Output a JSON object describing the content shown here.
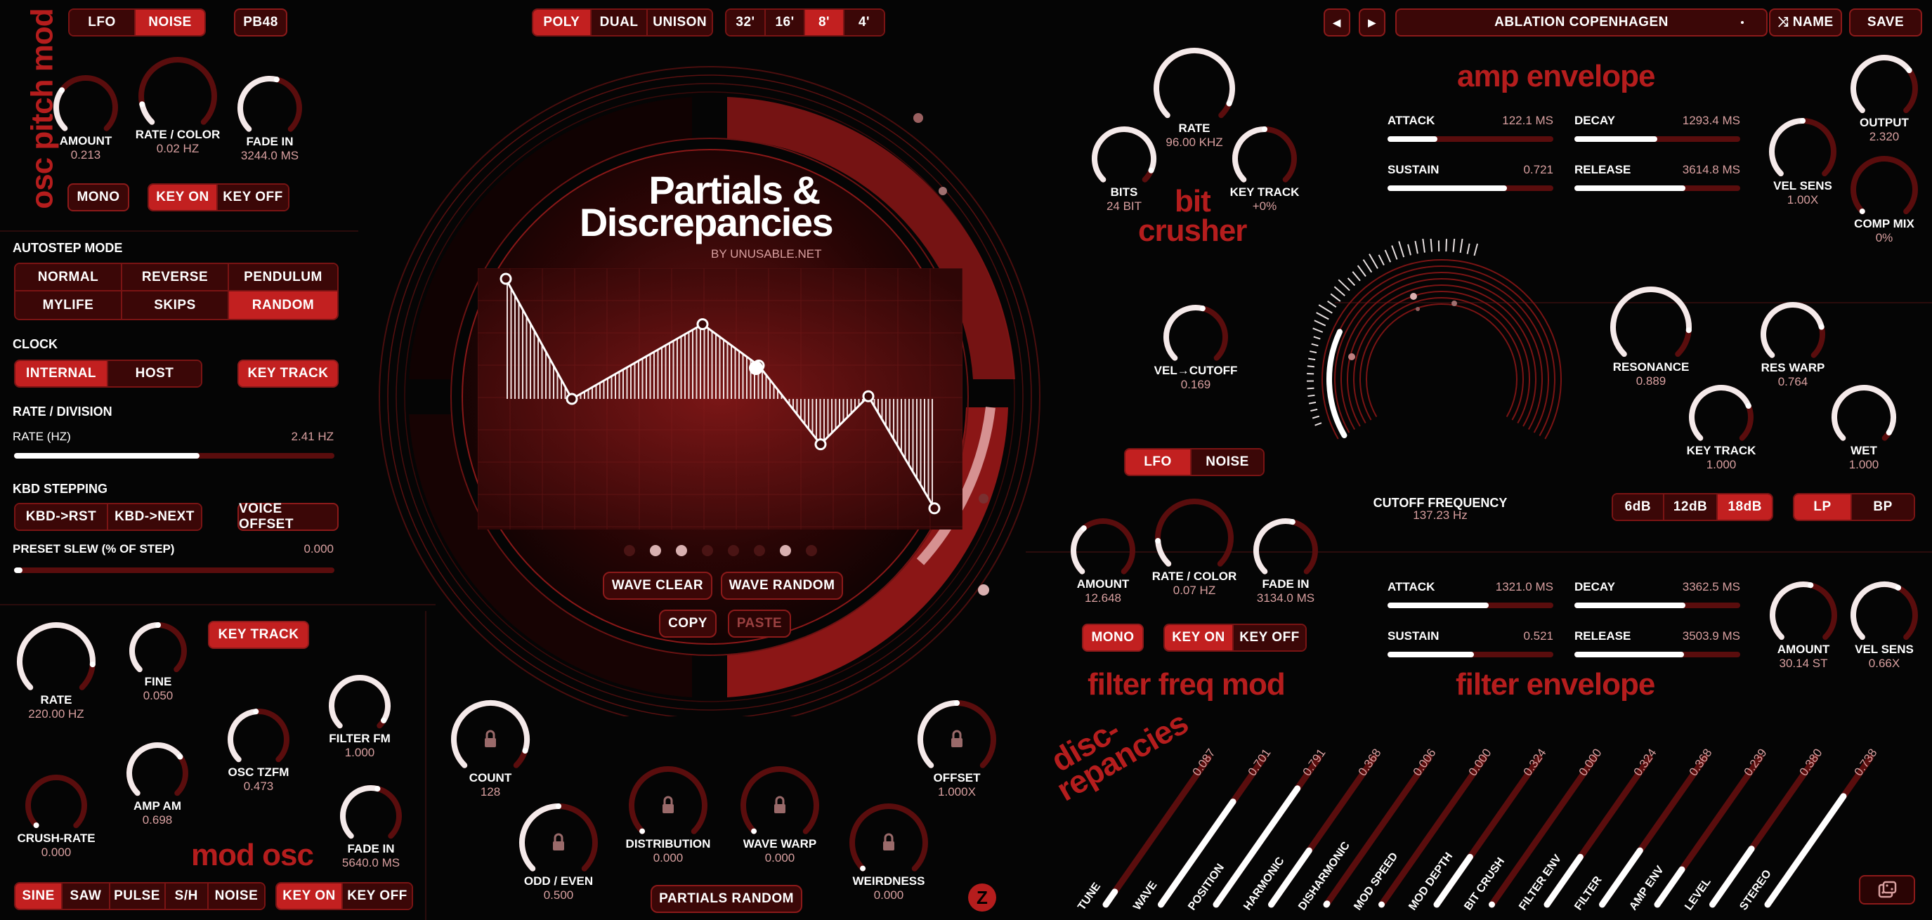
{
  "colors": {
    "accent": "#c22020",
    "dark": "#3b0707",
    "title": "#b51d1d"
  },
  "osc_pitch": {
    "title": "osc pitch mod",
    "src": [
      "LFO",
      "NOISE"
    ],
    "pb": "PB48",
    "knobs": [
      {
        "label": "AMOUNT",
        "value": "0.213"
      },
      {
        "label": "RATE / COLOR",
        "value": "0.02 HZ"
      },
      {
        "label": "FADE IN",
        "value": "3244.0 MS"
      }
    ],
    "mono": "MONO",
    "key_on": "KEY ON",
    "key_off": "KEY OFF"
  },
  "autostep": {
    "title": "AUTOSTEP MODE",
    "modes": [
      "NORMAL",
      "REVERSE",
      "PENDULUM",
      "MYLIFE",
      "SKIPS",
      "RANDOM"
    ],
    "clock_title": "CLOCK",
    "clock": [
      "INTERNAL",
      "HOST"
    ],
    "key_track": "KEY TRACK",
    "rate_title": "RATE / DIVISION",
    "rate_label": "RATE (HZ)",
    "rate_value": "2.41 HZ",
    "rate_fill": 0.58,
    "kbd_title": "KBD STEPPING",
    "kbd": [
      "KBD->RST",
      "KBD->NEXT"
    ],
    "voice_offset": "VOICE OFFSET",
    "slew_label": "PRESET SLEW (% OF STEP)",
    "slew_value": "0.000",
    "slew_fill": 0.0
  },
  "modosc": {
    "title": "mod osc",
    "key_track": "KEY TRACK",
    "knobs": [
      {
        "label": "RATE",
        "value": "220.00 HZ"
      },
      {
        "label": "FINE",
        "value": "0.050"
      },
      {
        "label": "FILTER FM",
        "value": "1.000"
      },
      {
        "label": "OSC TZFM",
        "value": "0.473"
      },
      {
        "label": "AMP AM",
        "value": "0.698"
      },
      {
        "label": "CRUSH-RATE",
        "value": "0.000"
      },
      {
        "label": "FADE IN",
        "value": "5640.0 MS"
      }
    ],
    "waves": [
      "SINE",
      "SAW",
      "PULSE",
      "S/H",
      "NOISE"
    ],
    "key_on": "KEY ON",
    "key_off": "KEY OFF"
  },
  "top": {
    "voice": [
      "POLY",
      "DUAL",
      "UNISON"
    ],
    "octave": [
      "32'",
      "16'",
      "8'",
      "4'"
    ]
  },
  "center": {
    "title1": "Partials &",
    "title2": "Discrepancies",
    "by": "BY UNUSABLE.NET",
    "wave_clear": "WAVE CLEAR",
    "wave_random": "WAVE RANDOM",
    "copy": "COPY",
    "paste": "PASTE",
    "knobs": [
      {
        "label": "COUNT",
        "value": "128"
      },
      {
        "label": "ODD / EVEN",
        "value": "0.500"
      },
      {
        "label": "DISTRIBUTION",
        "value": "0.000"
      },
      {
        "label": "WAVE WARP",
        "value": "0.000"
      },
      {
        "label": "WEIRDNESS",
        "value": "0.000"
      },
      {
        "label": "OFFSET",
        "value": "1.000X"
      }
    ],
    "partials_random": "PARTIALS RANDOM"
  },
  "preset": {
    "prev": "◀",
    "next": "▶",
    "name": "ABLATION COPENHAGEN",
    "rand_name": "⤨ NAME",
    "save": "SAVE"
  },
  "bitcrusher": {
    "title1": "bit",
    "title2": "crusher",
    "knobs": [
      {
        "label": "RATE",
        "value": "96.00 KHZ"
      },
      {
        "label": "BITS",
        "value": "24 BIT"
      },
      {
        "label": "KEY TRACK",
        "value": "+0%"
      },
      {
        "label": "VEL→CUTOFF",
        "value": "0.169"
      }
    ]
  },
  "amp_env": {
    "title": "amp envelope",
    "params": [
      {
        "label": "ATTACK",
        "value": "122.1 MS",
        "fill": 0.3
      },
      {
        "label": "DECAY",
        "value": "1293.4 MS",
        "fill": 0.5
      },
      {
        "label": "SUSTAIN",
        "value": "0.721",
        "fill": 0.72
      },
      {
        "label": "RELEASE",
        "value": "3614.8 MS",
        "fill": 0.67
      }
    ],
    "knobs": [
      {
        "label": "OUTPUT",
        "value": "2.320"
      },
      {
        "label": "VEL SENS",
        "value": "1.00X"
      },
      {
        "label": "COMP MIX",
        "value": "0%"
      }
    ]
  },
  "filter": {
    "cutoff_label": "CUTOFF FREQUENCY",
    "cutoff_value": "137.23 Hz",
    "knobs": [
      {
        "label": "RESONANCE",
        "value": "0.889"
      },
      {
        "label": "RES WARP",
        "value": "0.764"
      },
      {
        "label": "KEY TRACK",
        "value": "1.000"
      },
      {
        "label": "WET",
        "value": "1.000"
      }
    ],
    "slopes": [
      "6dB",
      "12dB",
      "18dB"
    ],
    "types": [
      "LP",
      "BP"
    ]
  },
  "filter_freq": {
    "title": "filter freq mod",
    "src": [
      "LFO",
      "NOISE"
    ],
    "knobs": [
      {
        "label": "AMOUNT",
        "value": "12.648"
      },
      {
        "label": "RATE / COLOR",
        "value": "0.07 HZ"
      },
      {
        "label": "FADE IN",
        "value": "3134.0 MS"
      }
    ],
    "mono": "MONO",
    "key_on": "KEY ON",
    "key_off": "KEY OFF"
  },
  "filter_env": {
    "title": "filter envelope",
    "params": [
      {
        "label": "ATTACK",
        "value": "1321.0 MS",
        "fill": 0.61
      },
      {
        "label": "DECAY",
        "value": "3362.5 MS",
        "fill": 0.67
      },
      {
        "label": "SUSTAIN",
        "value": "0.521",
        "fill": 0.52
      },
      {
        "label": "RELEASE",
        "value": "3503.9 MS",
        "fill": 0.66
      }
    ],
    "knobs": [
      {
        "label": "AMOUNT",
        "value": "30.14 ST"
      },
      {
        "label": "VEL SENS",
        "value": "0.66X"
      }
    ]
  },
  "disc": {
    "title1": "disc-",
    "title2": "repancies",
    "params": [
      {
        "label": "TUNE",
        "value": "0.087"
      },
      {
        "label": "WAVE",
        "value": "0.701"
      },
      {
        "label": "POSITION",
        "value": "0.791"
      },
      {
        "label": "HARMONIC",
        "value": "0.368"
      },
      {
        "label": "DISHARMONIC",
        "value": "0.006"
      },
      {
        "label": "MOD SPEED",
        "value": "0.000"
      },
      {
        "label": "MOD DEPTH",
        "value": "0.324"
      },
      {
        "label": "BIT CRUSH",
        "value": "0.000"
      },
      {
        "label": "FILTER ENV",
        "value": "0.324"
      },
      {
        "label": "FILTER",
        "value": "0.368"
      },
      {
        "label": "AMP ENV",
        "value": "0.239"
      },
      {
        "label": "LEVEL",
        "value": "0.380"
      },
      {
        "label": "STEREO",
        "value": "0.738"
      }
    ]
  },
  "partials": [
    0.9,
    0.7,
    0.55,
    0.4,
    0.25,
    0.02,
    0.15,
    0.3,
    0.45,
    0.62,
    0.58,
    0.32,
    0.08,
    -0.15,
    -0.22,
    -0.28,
    -0.4,
    -0.2,
    -0.05,
    -0.35,
    -0.6,
    -0.8
  ]
}
